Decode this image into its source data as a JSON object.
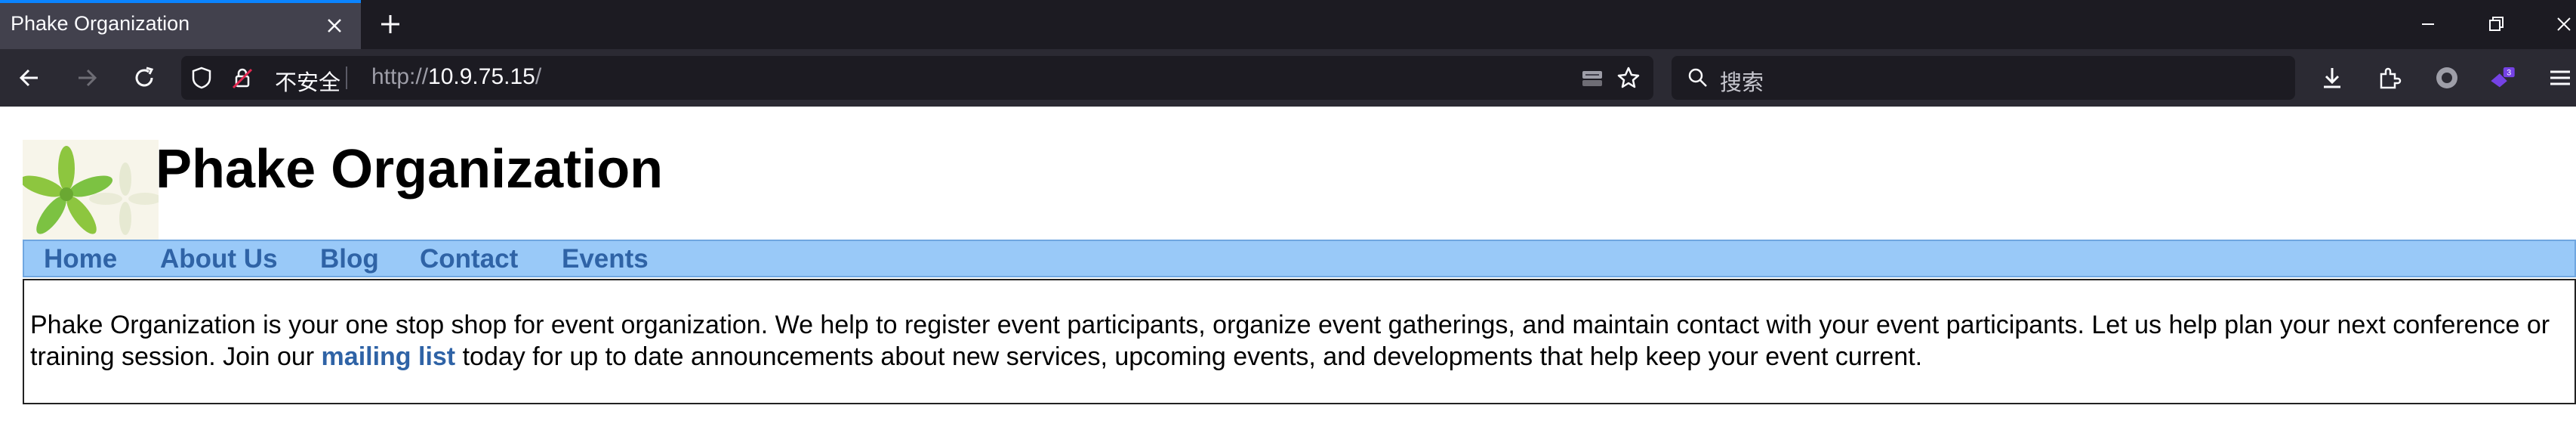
{
  "browser": {
    "tab_title": "Phake Organization",
    "security_label": "不安全",
    "url_scheme": "http://",
    "url_host": "10.9.75.15",
    "url_path": "/",
    "search_placeholder": "搜索",
    "extension_badge": "3"
  },
  "site": {
    "title": "Phake Organization",
    "nav": [
      "Home",
      "About Us",
      "Blog",
      "Contact",
      "Events"
    ],
    "intro_before_link": "Phake Organization is your one stop shop for event organization. We help to register event participants, organize event gatherings, and maintain contact with your event participants. Let us help plan your next conference or training session. Join our ",
    "intro_link": "mailing list",
    "intro_after_link": " today for up to date announcements about new services, upcoming events, and developments that help keep your event current."
  },
  "colors": {
    "menu_bg": "#99c9f8",
    "link": "#2f63a6",
    "tab_accent": "#0a84ff"
  }
}
